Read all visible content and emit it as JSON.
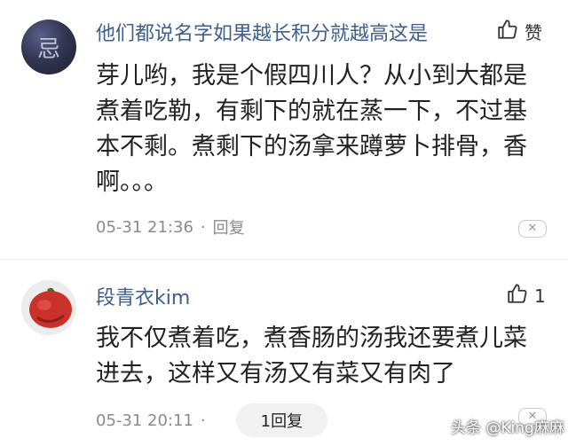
{
  "comments": [
    {
      "username": "他们都说名字如果越长积分就越高这是",
      "like_label": "赞",
      "like_icon": "thumbs-up-icon",
      "avatar_glyph": "忌",
      "text": "芽儿哟，我是个假四川人？从小到大都是煮着吃勒，有剩下的就在蒸一下，不过基本不剩。煮剩下的汤拿来蹲萝卜排骨，香啊。。。",
      "timestamp": "05-31 21:36",
      "separator": "·",
      "reply_label": "回复",
      "dismiss_icon": "close-icon"
    },
    {
      "username": "段青衣kim",
      "like_count": "1",
      "like_icon": "thumbs-up-icon",
      "text": "我不仅煮着吃，煮香肠的汤我还要煮儿菜进去，这样又有汤又有菜又有肉了",
      "timestamp": "05-31 20:11",
      "separator": "·",
      "reply_label": "1回复",
      "dismiss_icon": "close-icon"
    }
  ],
  "watermark": "头条 @King麻麻"
}
